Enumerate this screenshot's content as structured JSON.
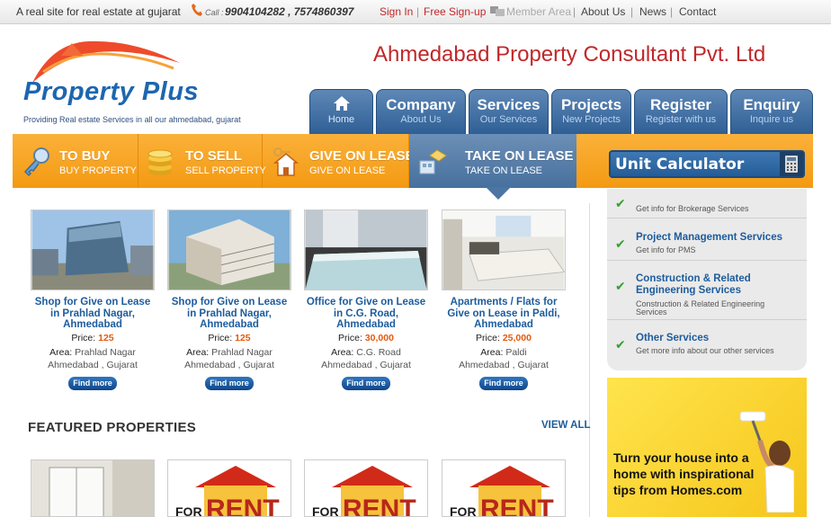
{
  "topbar": {
    "tagline": "A real site for real estate at gujarat",
    "call_word": "Call :",
    "phones": "9904104282 , 7574860397",
    "sign_in": "Sign In",
    "separator": "|",
    "sign_up": "Free Sign-up",
    "member_area": "Member Area",
    "about": "About Us",
    "news": "News",
    "contact": "Contact"
  },
  "logo": {
    "text": "Property Plus",
    "subtitle": "Providing Real estate Services in all our ahmedabad, gujarat"
  },
  "company_name": "Ahmedabad Property Consultant Pvt. Ltd",
  "nav": [
    {
      "title": "",
      "sub": "Home",
      "icon": "home-icon"
    },
    {
      "title": "Company",
      "sub": "About Us"
    },
    {
      "title": "Services",
      "sub": "Our Services"
    },
    {
      "title": "Projects",
      "sub": "New Projects"
    },
    {
      "title": "Register",
      "sub": "Register with us"
    },
    {
      "title": "Enquiry",
      "sub": "Inquire us"
    }
  ],
  "categories": [
    {
      "title": "TO BUY",
      "sub": "BUY PROPERTY",
      "icon": "key-icon"
    },
    {
      "title": "TO SELL",
      "sub": "SELL PROPERTY",
      "icon": "coins-icon"
    },
    {
      "title": "GIVE ON LEASE",
      "sub": "GIVE ON LEASE",
      "icon": "house-key-icon"
    },
    {
      "title": "TAKE ON LEASE",
      "sub": "TAKE ON LEASE",
      "icon": "handshake-icon",
      "active": true
    }
  ],
  "unit_calculator": {
    "label": "Unit Calculator",
    "icon": "calculator-icon"
  },
  "services": [
    {
      "title": "",
      "desc": "Get info for Brokerage Services"
    },
    {
      "title": "Project Management Services",
      "desc": "Get info for PMS"
    },
    {
      "title": "Construction & Related Engineering Services",
      "title1": "Construction & Related",
      "title2": "Engineering Services",
      "desc1": "Construction & Related Engineering",
      "desc2": "Services"
    },
    {
      "title": "Other Services",
      "desc": "Get more info about our other services"
    }
  ],
  "ad": {
    "line1": "Turn your house into a",
    "line2": "home with inspirational",
    "line3": "tips from Homes.com"
  },
  "properties": [
    {
      "title1": "Shop for Give on Lease",
      "title2": "in Prahlad Nagar,",
      "title3": "Ahmedabad",
      "price_label": "Price:",
      "price": "125",
      "area_label": "Area:",
      "area": "Prahlad Nagar",
      "city": "Ahmedabad , Gujarat",
      "button": "Find more"
    },
    {
      "title1": "Shop for Give on Lease",
      "title2": "in Prahlad Nagar,",
      "title3": "Ahmedabad",
      "price_label": "Price:",
      "price": "125",
      "area_label": "Area:",
      "area": "Prahlad Nagar",
      "city": "Ahmedabad , Gujarat",
      "button": "Find more"
    },
    {
      "title1": "Office for Give on Lease",
      "title2": "in C.G. Road,",
      "title3": "Ahmedabad",
      "price_label": "Price:",
      "price": "30,000",
      "area_label": "Area:",
      "area": "C.G. Road",
      "city": "Ahmedabad , Gujarat",
      "button": "Find more"
    },
    {
      "title1": "Apartments / Flats for",
      "title2": "Give on Lease in Paldi,",
      "title3": "Ahmedabad",
      "price_label": "Price:",
      "price": "25,000",
      "area_label": "Area:",
      "area": "Paldi",
      "city": "Ahmedabad , Gujarat",
      "button": "Find more"
    }
  ],
  "featured": {
    "heading": "FEATURED PROPERTIES",
    "view_all": "VIEW ALL"
  },
  "colors": {
    "brand_blue": "#2f5f95",
    "accent_orange": "#f39a12",
    "brand_red": "#c0282a"
  }
}
